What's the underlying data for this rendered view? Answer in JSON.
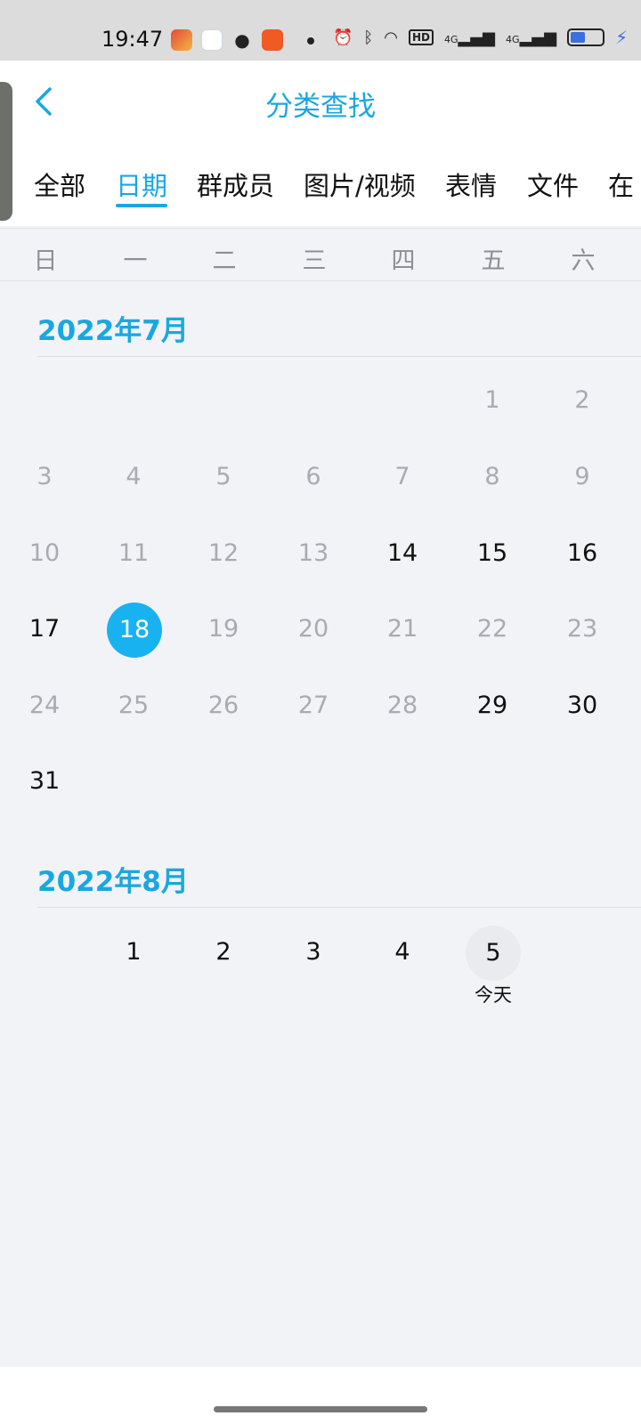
{
  "status_bar": {
    "time": "19:47",
    "signal_left": "4G",
    "signal_right": "4G",
    "hd": "HD"
  },
  "header": {
    "title": "分类查找",
    "tabs": [
      "全部",
      "日期",
      "群成员",
      "图片/视频",
      "表情",
      "文件",
      "在"
    ],
    "active_tab": "日期"
  },
  "weekdays": [
    "日",
    "一",
    "二",
    "三",
    "四",
    "五",
    "六"
  ],
  "months": [
    {
      "title": "2022年7月",
      "rows": [
        [
          "",
          "",
          "",
          "",
          "",
          "1",
          "2"
        ],
        [
          "3",
          "4",
          "5",
          "6",
          "7",
          "8",
          "9"
        ],
        [
          "10",
          "11",
          "12",
          "13",
          "14",
          "15",
          "16"
        ],
        [
          "17",
          "18",
          "19",
          "20",
          "21",
          "22",
          "23"
        ],
        [
          "24",
          "25",
          "26",
          "27",
          "28",
          "29",
          "30"
        ],
        [
          "31",
          "",
          "",
          "",
          "",
          "",
          ""
        ]
      ]
    },
    {
      "title": "2022年8月",
      "rows": [
        [
          "",
          "1",
          "2",
          "3",
          "4",
          "5",
          ""
        ]
      ],
      "today_label": "今天"
    }
  ],
  "colors": {
    "accent": "#1aa7e0",
    "selected": "#19b2f0",
    "past": "#a9abb0"
  }
}
